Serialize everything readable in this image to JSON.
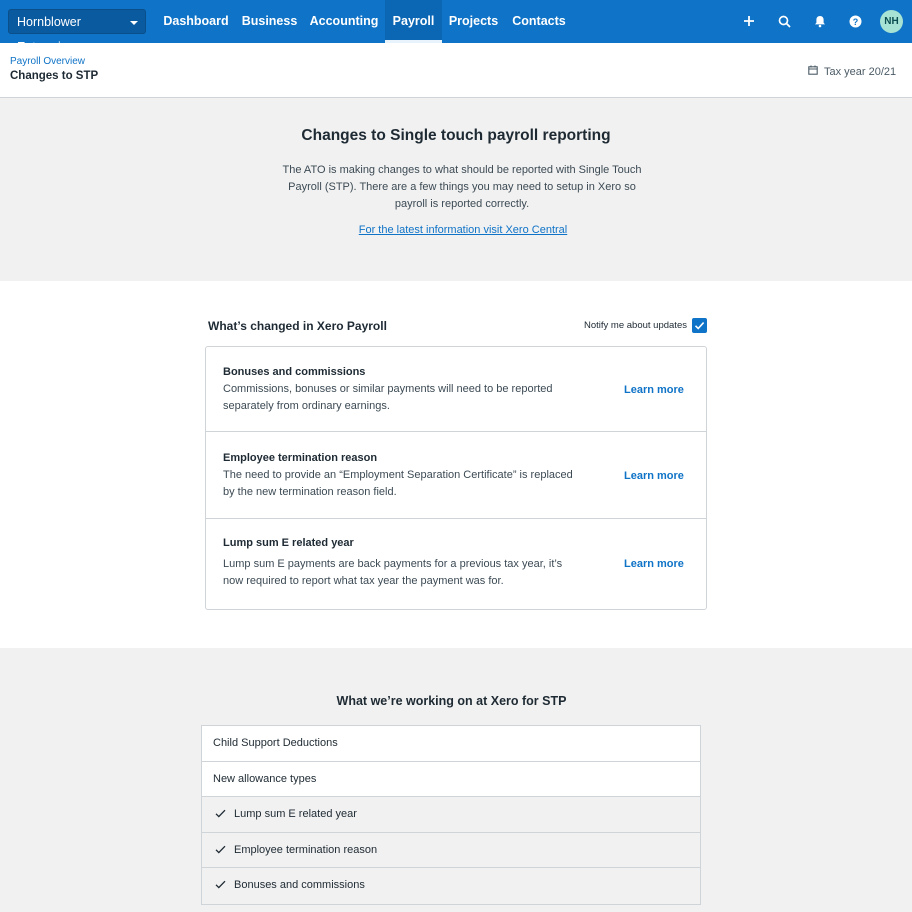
{
  "nav": {
    "org_name": "Hornblower Enterprises",
    "links": [
      "Dashboard",
      "Business",
      "Accounting",
      "Payroll",
      "Projects",
      "Contacts"
    ],
    "active": "Payroll",
    "icons": [
      "plus-icon",
      "search-icon",
      "bell-icon",
      "help-icon"
    ],
    "avatar_initials": "NH"
  },
  "subheader": {
    "breadcrumb": "Payroll Overview",
    "title": "Changes to STP",
    "tax_year": "Tax year 20/21"
  },
  "intro": {
    "heading": "Changes to Single touch payroll reporting",
    "body": "The ATO is making changes to what should be reported with Single Touch Payroll (STP). There are a few things you may need to setup in Xero so payroll is reported correctly.",
    "link": "For the latest information visit Xero Central"
  },
  "changes": {
    "title": "What’s changed in Xero Payroll",
    "notify_label": "Notify me about updates",
    "notify_checked": true,
    "items": [
      {
        "title": "Bonuses and commissions",
        "description": "Commissions, bonuses or similar payments will need to be reported separately from ordinary earnings.",
        "action": "Learn more"
      },
      {
        "title": "Employee termination reason",
        "description": "The need to provide an “Employment Separation Certificate” is replaced by the new termination reason field.",
        "action": "Learn more"
      },
      {
        "title": "Lump sum E related year",
        "description": "Lump sum E payments are back payments for a previous tax year, it’s now required to report what tax year the payment was for.",
        "action": "Learn more"
      }
    ]
  },
  "working": {
    "title": "What we’re working on at Xero for STP",
    "items": [
      {
        "label": "Child Support Deductions",
        "done": false
      },
      {
        "label": "New allowance types",
        "done": false
      },
      {
        "label": "Lump sum E related year",
        "done": true
      },
      {
        "label": "Employee termination reason",
        "done": true
      },
      {
        "label": "Bonuses and commissions",
        "done": true
      }
    ]
  },
  "colors": {
    "nav_blue": "#0f73c7",
    "link_blue": "#0f73c7",
    "avatar_green": "#a7e3d4",
    "panel_gray": "#f1f1f1"
  }
}
